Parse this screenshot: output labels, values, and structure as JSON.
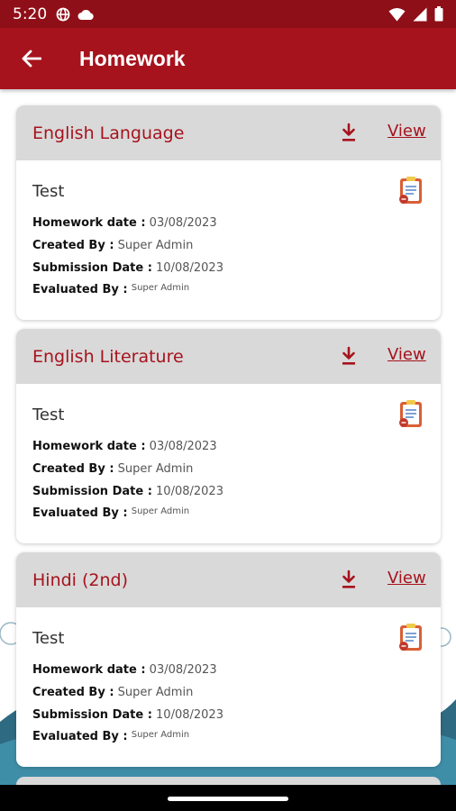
{
  "status_bar": {
    "time": "5:20",
    "left_icons": [
      "vpn-globe-icon",
      "cloud-icon"
    ],
    "right_icons": [
      "wifi-icon",
      "signal-icon",
      "battery-icon"
    ]
  },
  "app_bar": {
    "title": "Homework",
    "back_icon": "arrow-left-icon"
  },
  "labels": {
    "homework_date": "Homework date :",
    "created_by": "Created By :",
    "submission_date": "Submission Date :",
    "evaluated_by": "Evaluated By :",
    "view": "View"
  },
  "homework_items": [
    {
      "subject": "English Language",
      "title": "Test",
      "homework_date": "03/08/2023",
      "created_by": "Super Admin",
      "submission_date": "10/08/2023",
      "evaluated_by": "Super Admin"
    },
    {
      "subject": "English Literature",
      "title": "Test",
      "homework_date": "03/08/2023",
      "created_by": "Super Admin",
      "submission_date": "10/08/2023",
      "evaluated_by": "Super Admin"
    },
    {
      "subject": "Hindi (2nd)",
      "title": "Test",
      "homework_date": "03/08/2023",
      "created_by": "Super Admin",
      "submission_date": "10/08/2023",
      "evaluated_by": "Super Admin"
    }
  ],
  "colors": {
    "primary": "#a6131d",
    "status_bar": "#8f0f18",
    "card_header": "#d9d9d9"
  }
}
